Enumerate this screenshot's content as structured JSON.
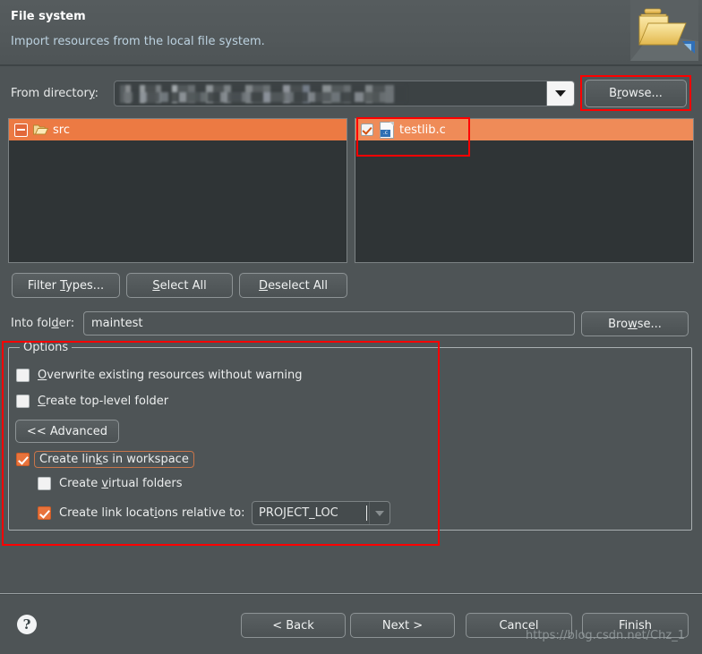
{
  "header": {
    "title": "File system",
    "description": "Import resources from the local file system.",
    "icon": "import-folder-icon"
  },
  "from_directory": {
    "label": "From directory:",
    "label_mnemonic": "y",
    "value": "",
    "value_censored": true,
    "dropdown_icon": "chevron-down-icon",
    "browse_label": "Browse...",
    "browse_mnemonic": "r"
  },
  "trees": {
    "left": {
      "items": [
        {
          "label": "src",
          "icon": "folder-open-icon",
          "expander": "collapse-minus-icon",
          "selected": true
        }
      ]
    },
    "right": {
      "items": [
        {
          "label": "testlib.c",
          "icon": "c-file-icon",
          "checked": true,
          "selected": true,
          "badge": ".c"
        }
      ]
    }
  },
  "filter_buttons": {
    "filter_types": "Filter Types...",
    "filter_types_mnemonic": "T",
    "select_all": "Select All",
    "select_all_mnemonic": "S",
    "deselect_all": "Deselect All",
    "deselect_all_mnemonic": "D"
  },
  "into_folder": {
    "label": "Into folder:",
    "label_mnemonic": "d",
    "value": "maintest",
    "browse_label": "Browse...",
    "browse_mnemonic": "w"
  },
  "options": {
    "group_title": "Options",
    "overwrite": {
      "label": "Overwrite existing resources without warning",
      "mnemonic": "O",
      "checked": false
    },
    "top_level": {
      "label": "Create top-level folder",
      "mnemonic": "C",
      "checked": false
    },
    "advanced_button": "<< Advanced",
    "create_links": {
      "label": "Create links in workspace",
      "mnemonic": "k",
      "checked": true,
      "focused": true
    },
    "virtual_folders": {
      "label": "Create virtual folders",
      "mnemonic": "v",
      "checked": false
    },
    "relative_to": {
      "label": "Create link locations relative to:",
      "mnemonic": "i",
      "checked": true,
      "variable_value": "PROJECT_LOC",
      "dropdown_icon": "chevron-down-icon"
    }
  },
  "footer": {
    "help_icon": "help-question-icon",
    "back": "< Back",
    "next": "Next >",
    "cancel": "Cancel",
    "finish": "Finish"
  },
  "watermark": "https://blog.csdn.net/Chz_1",
  "annotations": {
    "color": "#ff0000",
    "boxes": [
      "browse-button",
      "testlib-file-row",
      "options-group"
    ]
  }
}
